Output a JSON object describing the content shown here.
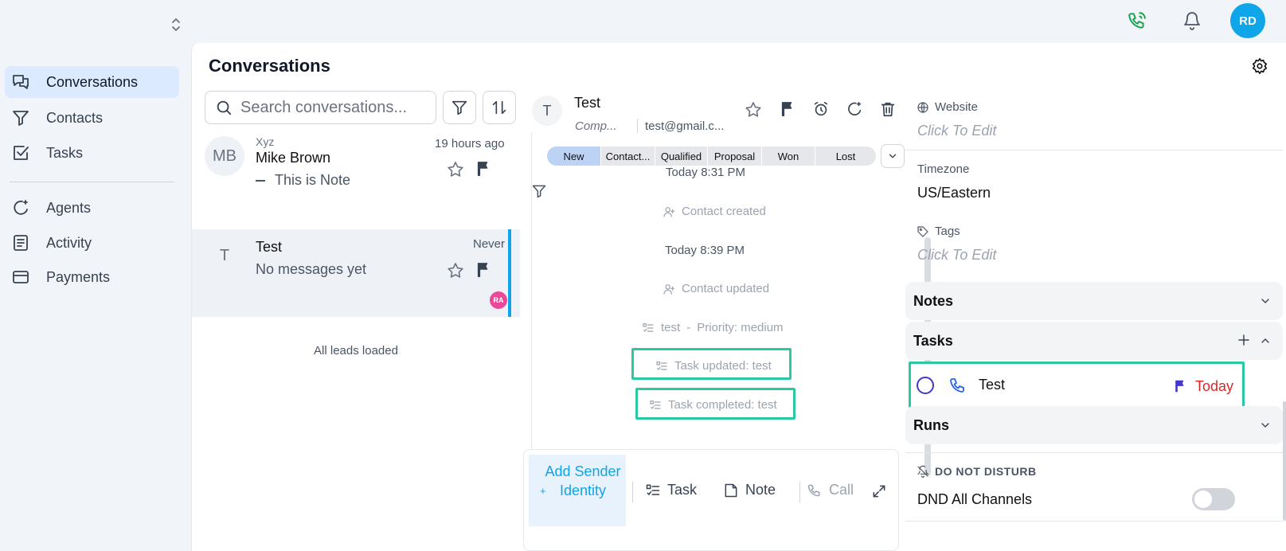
{
  "topbar": {
    "avatar_initials": "RD"
  },
  "sidebar": {
    "items": [
      {
        "label": "Conversations",
        "icon": "chat-bubbles-icon",
        "active": true
      },
      {
        "label": "Contacts",
        "icon": "funnel-icon"
      },
      {
        "label": "Tasks",
        "icon": "checkbox-icon"
      },
      {
        "label": "Agents",
        "icon": "sparkle-refresh-icon"
      },
      {
        "label": "Activity",
        "icon": "document-list-icon"
      },
      {
        "label": "Payments",
        "icon": "credit-card-icon"
      }
    ]
  },
  "main": {
    "title": "Conversations"
  },
  "conversations": {
    "search_placeholder": "Search conversations...",
    "items": [
      {
        "initials": "MB",
        "company": "Xyz",
        "name": "Mike Brown",
        "preview": "This is Note",
        "time": "19 hours ago"
      },
      {
        "initials": "T",
        "name": "Test",
        "preview": "No messages yet",
        "time": "Never",
        "assignee": "RA"
      }
    ],
    "footer": "All leads loaded"
  },
  "detail": {
    "contact_initial": "T",
    "contact_name": "Test",
    "company": "Comp...",
    "email": "test@gmail.c...",
    "pipeline": [
      "New",
      "Contact...",
      "Qualified",
      "Proposal",
      "Won",
      "Lost"
    ],
    "pipeline_current": "New",
    "timeline": {
      "time1": "Today 8:31 PM",
      "contact_created": "Contact created",
      "time2": "Today 8:39 PM",
      "contact_updated": "Contact updated",
      "task_test": "test",
      "task_sep": "-",
      "task_priority": "Priority: medium",
      "task_updated": "Task updated: test",
      "task_completed": "Task completed: test"
    },
    "composer": {
      "add_sender": "Add Sender Identity",
      "add_sender_plus": "+",
      "task": "Task",
      "note": "Note",
      "call": "Call"
    }
  },
  "right_panel": {
    "website_label": "Website",
    "website_value": "Click To Edit",
    "timezone_label": "Timezone",
    "timezone_value": "US/Eastern",
    "tags_label": "Tags",
    "tags_value": "Click To Edit",
    "notes_title": "Notes",
    "tasks_title": "Tasks",
    "task": {
      "name": "Test",
      "due": "Today"
    },
    "runs_title": "Runs",
    "dnd_label": "DO NOT DISTURB",
    "dnd_all": "DND All Channels",
    "dnd_enabled": false
  },
  "colors": {
    "accent": "#0ea5e9",
    "highlight": "#2bc9a1",
    "due_today": "#dc2626",
    "priority_flag": "#4338ca",
    "phone_green": "#16a34a"
  }
}
